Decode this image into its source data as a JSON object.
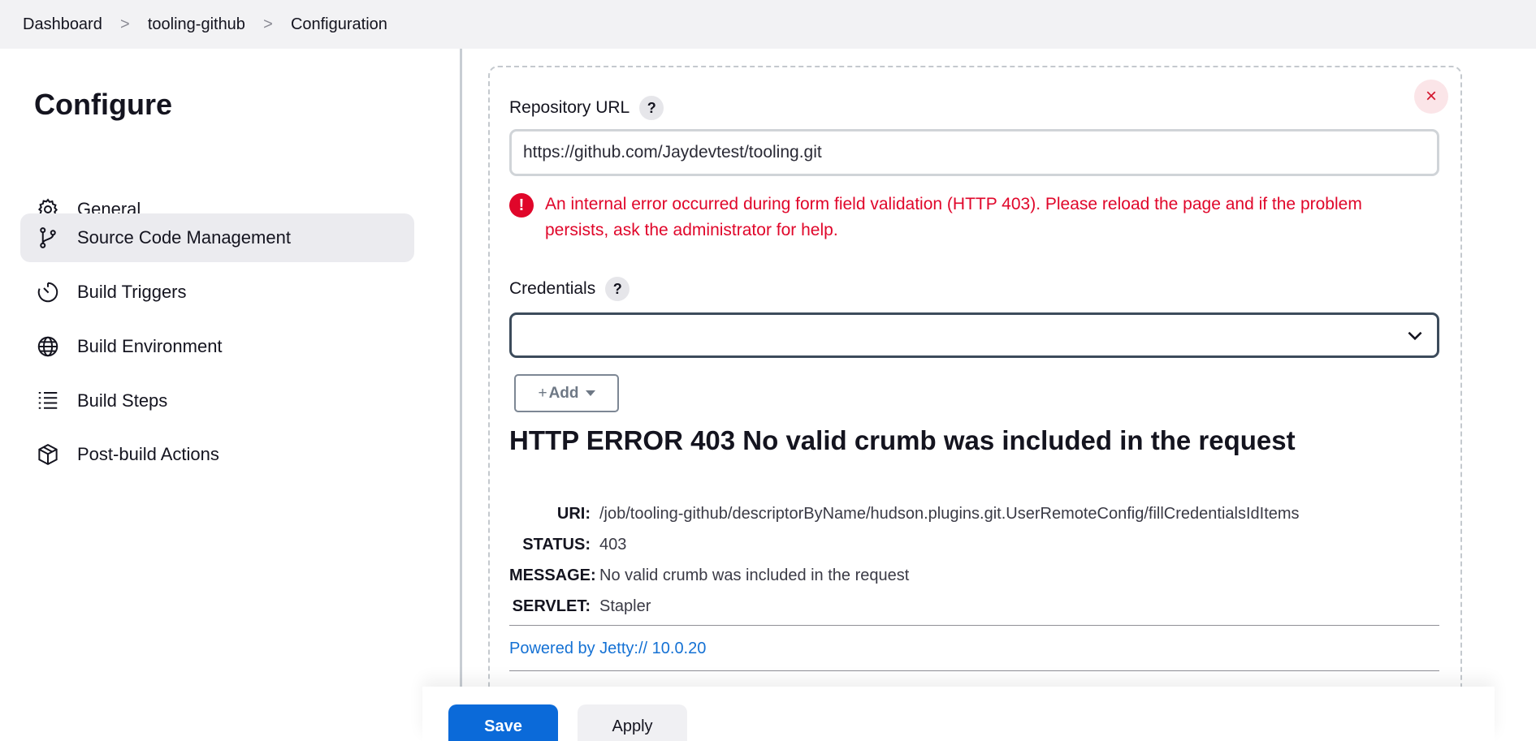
{
  "breadcrumb": {
    "items": [
      "Dashboard",
      "tooling-github",
      "Configuration"
    ],
    "separator": ">"
  },
  "sidebar": {
    "title": "Configure",
    "items": [
      {
        "label": "General",
        "icon": "gear-icon",
        "active": false
      },
      {
        "label": "Source Code Management",
        "icon": "git-branch-icon",
        "active": true
      },
      {
        "label": "Build Triggers",
        "icon": "timer-icon",
        "active": false
      },
      {
        "label": "Build Environment",
        "icon": "globe-icon",
        "active": false
      },
      {
        "label": "Build Steps",
        "icon": "list-icon",
        "active": false
      },
      {
        "label": "Post-build Actions",
        "icon": "package-icon",
        "active": false
      }
    ]
  },
  "scm": {
    "repo_label": "Repository URL",
    "repo_value": "https://github.com/Jaydevtest/tooling.git",
    "help_glyph": "?",
    "validation_error": "An internal error occurred during form field validation (HTTP 403). Please reload the page and if the problem persists, ask the administrator for help.",
    "error_glyph": "!",
    "credentials_label": "Credentials",
    "credentials_value": "",
    "add_label": "Add",
    "add_glyph": "+",
    "close_glyph": "×"
  },
  "http_error": {
    "title": "HTTP ERROR 403 No valid crumb was included in the request",
    "rows": [
      {
        "key": "URI:",
        "value": "/job/tooling-github/descriptorByName/hudson.plugins.git.UserRemoteConfig/fillCredentialsIdItems"
      },
      {
        "key": "STATUS:",
        "value": "403"
      },
      {
        "key": "MESSAGE:",
        "value": "No valid crumb was included in the request"
      },
      {
        "key": "SERVLET:",
        "value": "Stapler"
      }
    ],
    "powered_by": "Powered by Jetty:// 10.0.20"
  },
  "actions": {
    "save_label": "Save",
    "apply_label": "Apply"
  },
  "colors": {
    "accent": "#0b6ad9",
    "error": "#e0062a",
    "link": "#1471d4"
  }
}
